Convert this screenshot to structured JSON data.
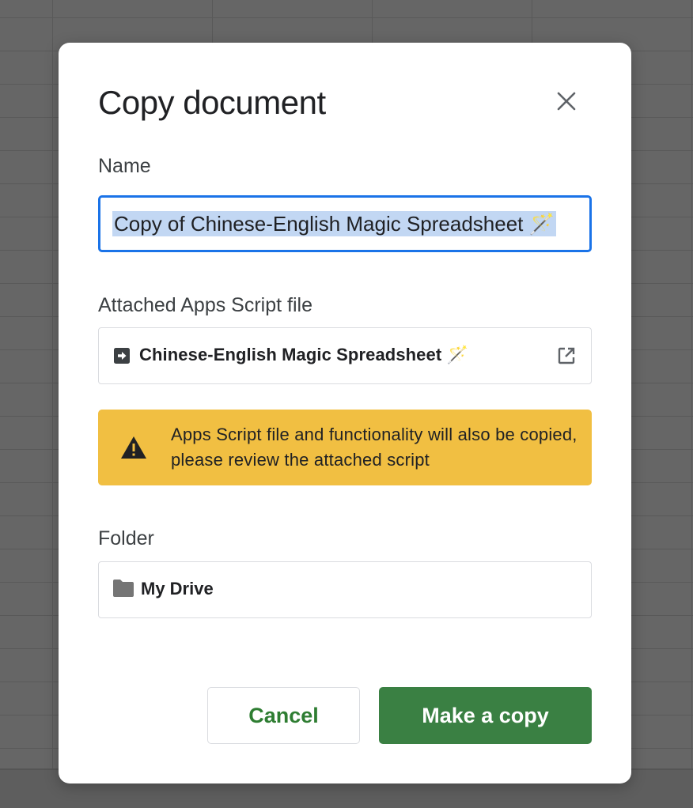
{
  "dialog": {
    "title": "Copy document",
    "close_icon": "close-icon"
  },
  "name_field": {
    "label": "Name",
    "value": "Copy of Chinese-English Magic Spreadsheet 🪄"
  },
  "apps_script": {
    "label": "Attached Apps Script file",
    "file_name": "Chinese-English Magic Spreadsheet 🪄",
    "file_icon": "apps-script-icon",
    "open_icon": "open-in-new-icon"
  },
  "warning": {
    "icon": "warning-icon",
    "text": "Apps Script file and functionality will also be copied, please review the attached script",
    "color": "#f1bf42"
  },
  "folder": {
    "label": "Folder",
    "value": "My Drive",
    "icon": "folder-icon"
  },
  "buttons": {
    "cancel_label": "Cancel",
    "make_copy_label": "Make a copy",
    "accent_color": "#3a8043"
  }
}
